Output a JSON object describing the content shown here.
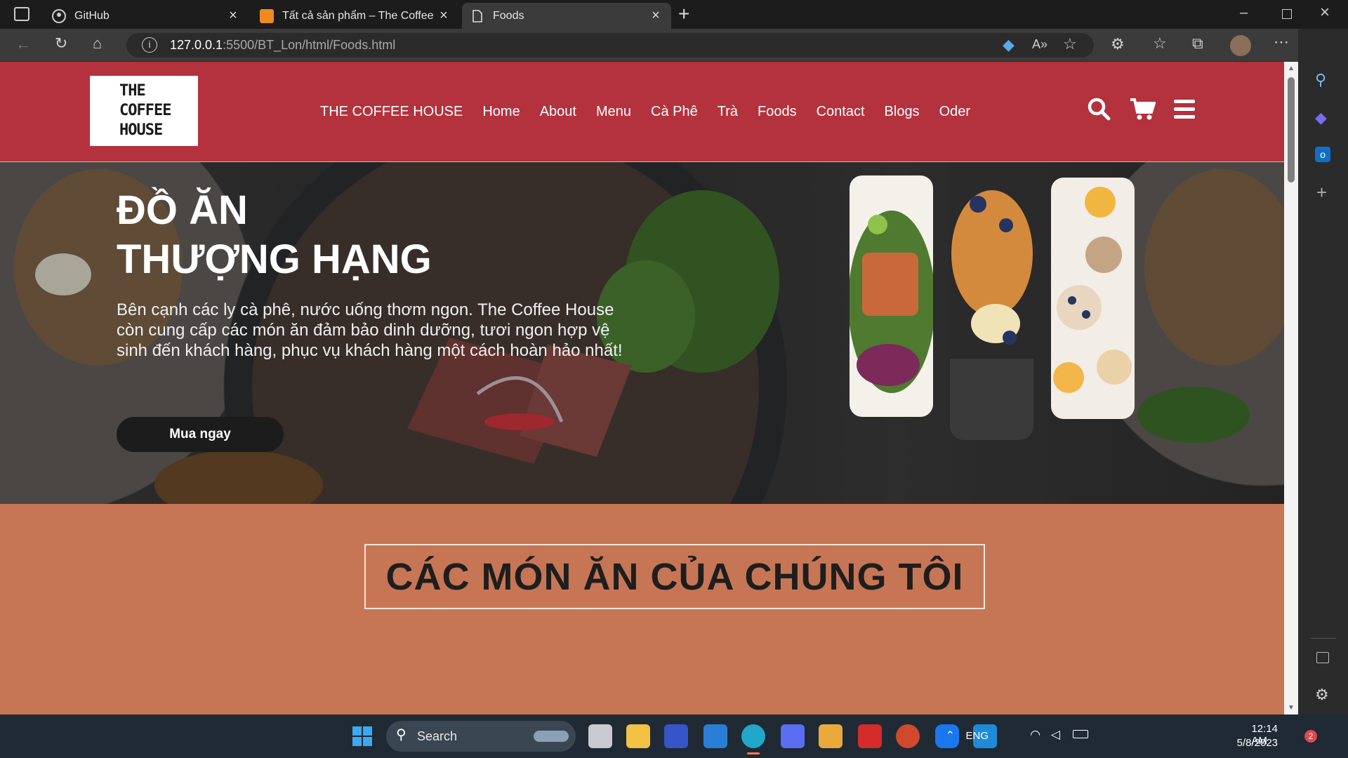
{
  "browser": {
    "tabs": [
      {
        "title": "GitHub",
        "icon": "github-icon"
      },
      {
        "title": "Tất cả sản phẩm – The Coffee House",
        "icon": "coffee-house-favicon"
      },
      {
        "title": "Foods",
        "icon": "page-icon"
      }
    ],
    "url_host": "127.0.0.1",
    "url_rest": ":5500/BT_Lon/html/Foods.html"
  },
  "site": {
    "logo_lines": [
      "THE",
      "COFFEE",
      "HOUSE"
    ],
    "nav": [
      "THE COFFEE HOUSE",
      "Home",
      "About",
      "Menu",
      "Cà Phê",
      "Trà",
      "Foods",
      "Contact",
      "Blogs",
      "Oder"
    ],
    "hero": {
      "title_line1": "ĐỒ ĂN",
      "title_line2": "THƯỢNG HẠNG",
      "description": "Bên cạnh các ly cà phê, nước uống thơm ngon. The Coffee House còn cung cấp các món ăn đảm bảo dinh dưỡng, tươi ngon hợp vệ sinh đến khách hàng, phục vụ khách hàng một cách hoàn hảo nhất!",
      "button": "Mua ngay"
    },
    "section_title": "CÁC MÓN ĂN CỦA CHÚNG TÔI"
  },
  "taskbar": {
    "search": "Search",
    "language": "ENG",
    "time": "12:14 AM",
    "date": "5/8/2023",
    "notifications": "2"
  },
  "colors": {
    "header": "#b3323d",
    "body": "#c77655",
    "button": "#1c1c1c"
  }
}
